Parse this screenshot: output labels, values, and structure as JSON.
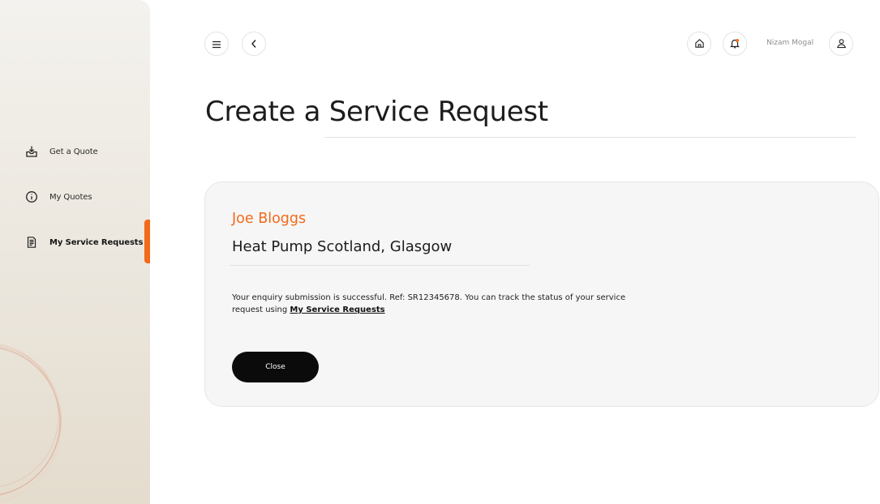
{
  "sidebar": {
    "items": [
      {
        "label": "Get a Quote",
        "icon": "inbox-download-icon"
      },
      {
        "label": "My Quotes",
        "icon": "info-circle-icon"
      },
      {
        "label": "My Service Requests",
        "icon": "document-list-icon",
        "active": true
      }
    ]
  },
  "topbar": {
    "menu_icon": "hamburger-menu-icon",
    "back_icon": "chevron-left-icon",
    "home_icon": "home-icon",
    "bell_icon": "bell-icon",
    "user_name": "Nizam Mogal",
    "user_icon": "user-icon"
  },
  "page": {
    "title": "Create a Service Request"
  },
  "card": {
    "customer_name": "Joe Bloggs",
    "company": "Heat Pump Scotland, Glasgow",
    "message_prefix": "Your enquiry submission is successful. Ref: SR12345678. You can track the status of your service request using ",
    "message_link": "My Service Requests",
    "close_label": "Close"
  },
  "colors": {
    "accent": "#f26a1b",
    "button_dark": "#0b0b0b",
    "card_bg": "#f6f6f6"
  }
}
